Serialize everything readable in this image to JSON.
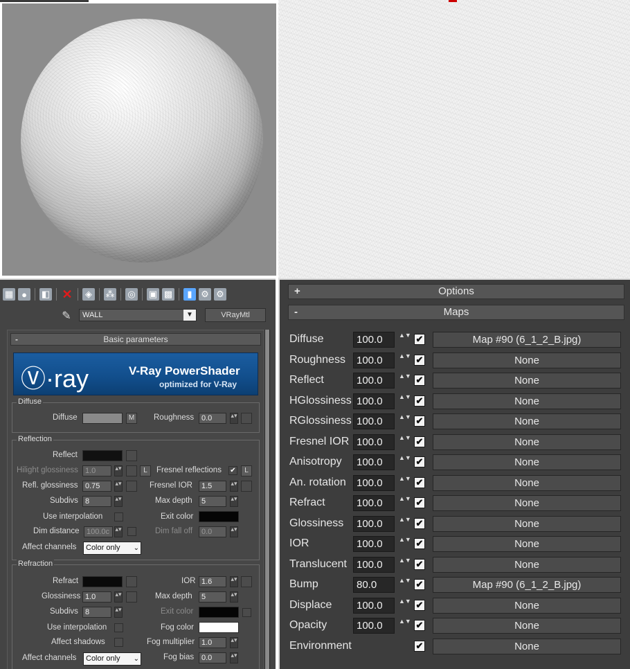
{
  "editor": {
    "material_name": "WALL",
    "material_type": "VRayMtl",
    "basic_params_title": "Basic parameters",
    "banner": {
      "logo": "Ⓥ·ray",
      "title": "V-Ray PowerShader",
      "subtitle": "optimized for V-Ray"
    },
    "diffuse": {
      "group": "Diffuse",
      "diffuse_label": "Diffuse",
      "m_label": "M",
      "roughness_label": "Roughness",
      "roughness_value": "0.0"
    },
    "reflection": {
      "group": "Reflection",
      "reflect_label": "Reflect",
      "hilight_label": "Hilight glossiness",
      "hilight_value": "1.0",
      "l_label": "L",
      "fresnel_label": "Fresnel reflections",
      "fresnel_checked": "✔",
      "refl_gloss_label": "Refl. glossiness",
      "refl_gloss_value": "0.75",
      "fresnel_ior_label": "Fresnel IOR",
      "fresnel_ior_value": "1.5",
      "subdivs_label": "Subdivs",
      "subdivs_value": "8",
      "max_depth_label": "Max depth",
      "max_depth_value": "5",
      "use_interp_label": "Use interpolation",
      "exit_color_label": "Exit color",
      "dim_distance_label": "Dim distance",
      "dim_distance_value": "100.0c",
      "dim_falloff_label": "Dim fall off",
      "dim_falloff_value": "0.0",
      "affect_channels_label": "Affect channels",
      "affect_channels_value": "Color only"
    },
    "refraction": {
      "group": "Refraction",
      "refract_label": "Refract",
      "ior_label": "IOR",
      "ior_value": "1.6",
      "glossiness_label": "Glossiness",
      "glossiness_value": "1.0",
      "max_depth_label": "Max depth",
      "max_depth_value": "5",
      "subdivs_label": "Subdivs",
      "subdivs_value": "8",
      "exit_color_label": "Exit color",
      "use_interp_label": "Use interpolation",
      "fog_color_label": "Fog color",
      "affect_shadows_label": "Affect shadows",
      "fog_mult_label": "Fog multiplier",
      "fog_mult_value": "1.0",
      "affect_channels_label": "Affect channels",
      "affect_channels_value": "Color only",
      "fog_bias_label": "Fog bias",
      "fog_bias_value": "0.0"
    }
  },
  "maps_panel": {
    "options_title": "Options",
    "maps_title": "Maps",
    "plus": "+",
    "minus": "-",
    "rows": [
      {
        "label": "Diffuse",
        "amount": "100.0",
        "checked": "✔",
        "map": "Map #90 (6_1_2_B.jpg)"
      },
      {
        "label": "Roughness",
        "amount": "100.0",
        "checked": "✔",
        "map": "None"
      },
      {
        "label": "Reflect",
        "amount": "100.0",
        "checked": "✔",
        "map": "None"
      },
      {
        "label": "HGlossiness",
        "amount": "100.0",
        "checked": "✔",
        "map": "None"
      },
      {
        "label": "RGlossiness",
        "amount": "100.0",
        "checked": "✔",
        "map": "None"
      },
      {
        "label": "Fresnel IOR",
        "amount": "100.0",
        "checked": "✔",
        "map": "None"
      },
      {
        "label": "Anisotropy",
        "amount": "100.0",
        "checked": "✔",
        "map": "None"
      },
      {
        "label": "An. rotation",
        "amount": "100.0",
        "checked": "✔",
        "map": "None"
      },
      {
        "label": "Refract",
        "amount": "100.0",
        "checked": "✔",
        "map": "None"
      },
      {
        "label": "Glossiness",
        "amount": "100.0",
        "checked": "✔",
        "map": "None"
      },
      {
        "label": "IOR",
        "amount": "100.0",
        "checked": "✔",
        "map": "None"
      },
      {
        "label": "Translucent",
        "amount": "100.0",
        "checked": "✔",
        "map": "None"
      },
      {
        "label": "Bump",
        "amount": "80.0",
        "checked": "✔",
        "map": "Map #90 (6_1_2_B.jpg)"
      },
      {
        "label": "Displace",
        "amount": "100.0",
        "checked": "✔",
        "map": "None"
      },
      {
        "label": "Opacity",
        "amount": "100.0",
        "checked": "✔",
        "map": "None"
      },
      {
        "label": "Environment",
        "amount": "",
        "checked": "✔",
        "map": "None"
      }
    ]
  },
  "colors": {
    "diffuse_swatch": "#8a8a8a",
    "reflect_swatch": "#111111",
    "refract_swatch": "#0a0a0a",
    "exit_color": "#050505",
    "fog_color": "#ffffff",
    "vray_blue": "#124f8d"
  },
  "icons": [
    "checker-icon",
    "get-material-icon",
    "put-material-icon",
    "delete-icon",
    "copy-icon",
    "unique-icon",
    "material-id-icon",
    "show-map-icon",
    "background-icon",
    "sample-type-icon",
    "options-icon",
    "eyedropper-icon"
  ]
}
